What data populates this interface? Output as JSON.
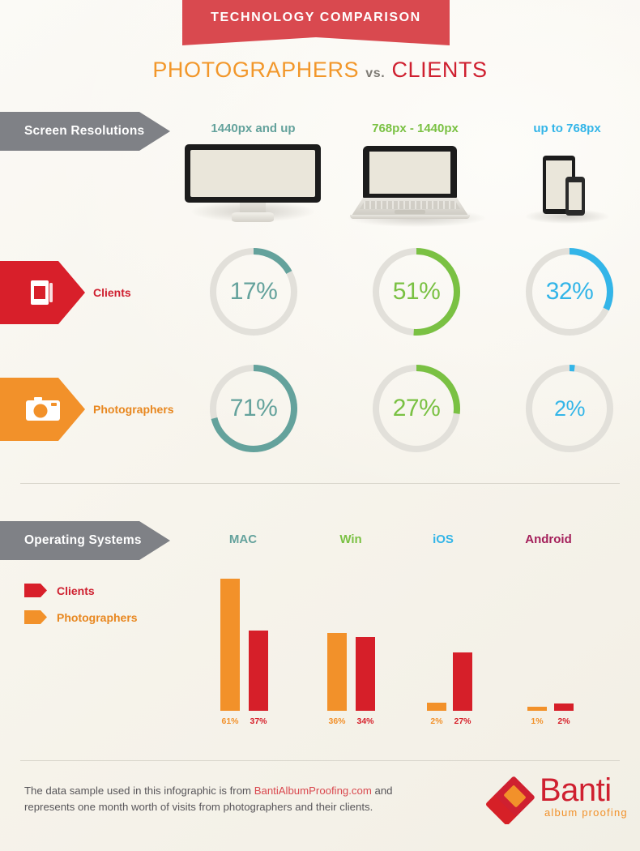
{
  "header": {
    "banner_title": "TECHNOLOGY COMPARISON",
    "subtitle_left": "PHOTOGRAPHERS",
    "subtitle_mid": "vs.",
    "subtitle_right": "CLIENTS",
    "banner_color": "#d9494f"
  },
  "sections": {
    "screen_resolutions_label": "Screen Resolutions",
    "operating_systems_label": "Operating Systems"
  },
  "devices": [
    {
      "label": "1440px and up",
      "color": "#64a29c",
      "icon": "desktop-monitor-icon"
    },
    {
      "label": "768px - 1440px",
      "color": "#7ac143",
      "icon": "laptop-icon"
    },
    {
      "label": "up to 768px",
      "color": "#33b5e8",
      "icon": "tablet-phone-icon"
    }
  ],
  "rows": [
    {
      "name": "Clients",
      "tag_color": "#d81f2a",
      "icon": "photo-album-icon",
      "values": [
        "17%",
        "51%",
        "32%"
      ],
      "numeric": [
        17,
        51,
        32
      ]
    },
    {
      "name": "Photographers",
      "tag_color": "#f2912a",
      "icon": "camera-icon",
      "values": [
        "71%",
        "27%",
        "2%"
      ],
      "numeric": [
        71,
        27,
        2
      ]
    }
  ],
  "legend": [
    {
      "label": "Clients",
      "color": "#d81f2a"
    },
    {
      "label": "Photographers",
      "color": "#f2912a"
    }
  ],
  "chart_data": {
    "type": "bar",
    "title": "Operating Systems",
    "categories": [
      "MAC",
      "Win",
      "iOS",
      "Android"
    ],
    "category_colors": [
      "#64a29c",
      "#7ac143",
      "#33b5e8",
      "#a41f5a"
    ],
    "series": [
      {
        "name": "Photographers",
        "color": "#f2912a",
        "values": [
          61,
          36,
          2,
          1
        ],
        "labels": [
          "61%",
          "36%",
          "2%",
          "1%"
        ]
      },
      {
        "name": "Clients",
        "color": "#d61f29",
        "values": [
          37,
          34,
          27,
          2
        ],
        "labels": [
          "37%",
          "34%",
          "27%",
          "2%"
        ]
      }
    ],
    "ylabel": "",
    "xlabel": "",
    "ylim": [
      0,
      61
    ],
    "grid": false,
    "legend_position": "left"
  },
  "footer": {
    "text_before": "The data sample used in this infographic is from ",
    "link": "BantiAlbumProofing.com",
    "text_after": " and represents one month worth of visits from photographers and their clients.",
    "logo_name": "Banti",
    "logo_tagline": "album proofing"
  }
}
